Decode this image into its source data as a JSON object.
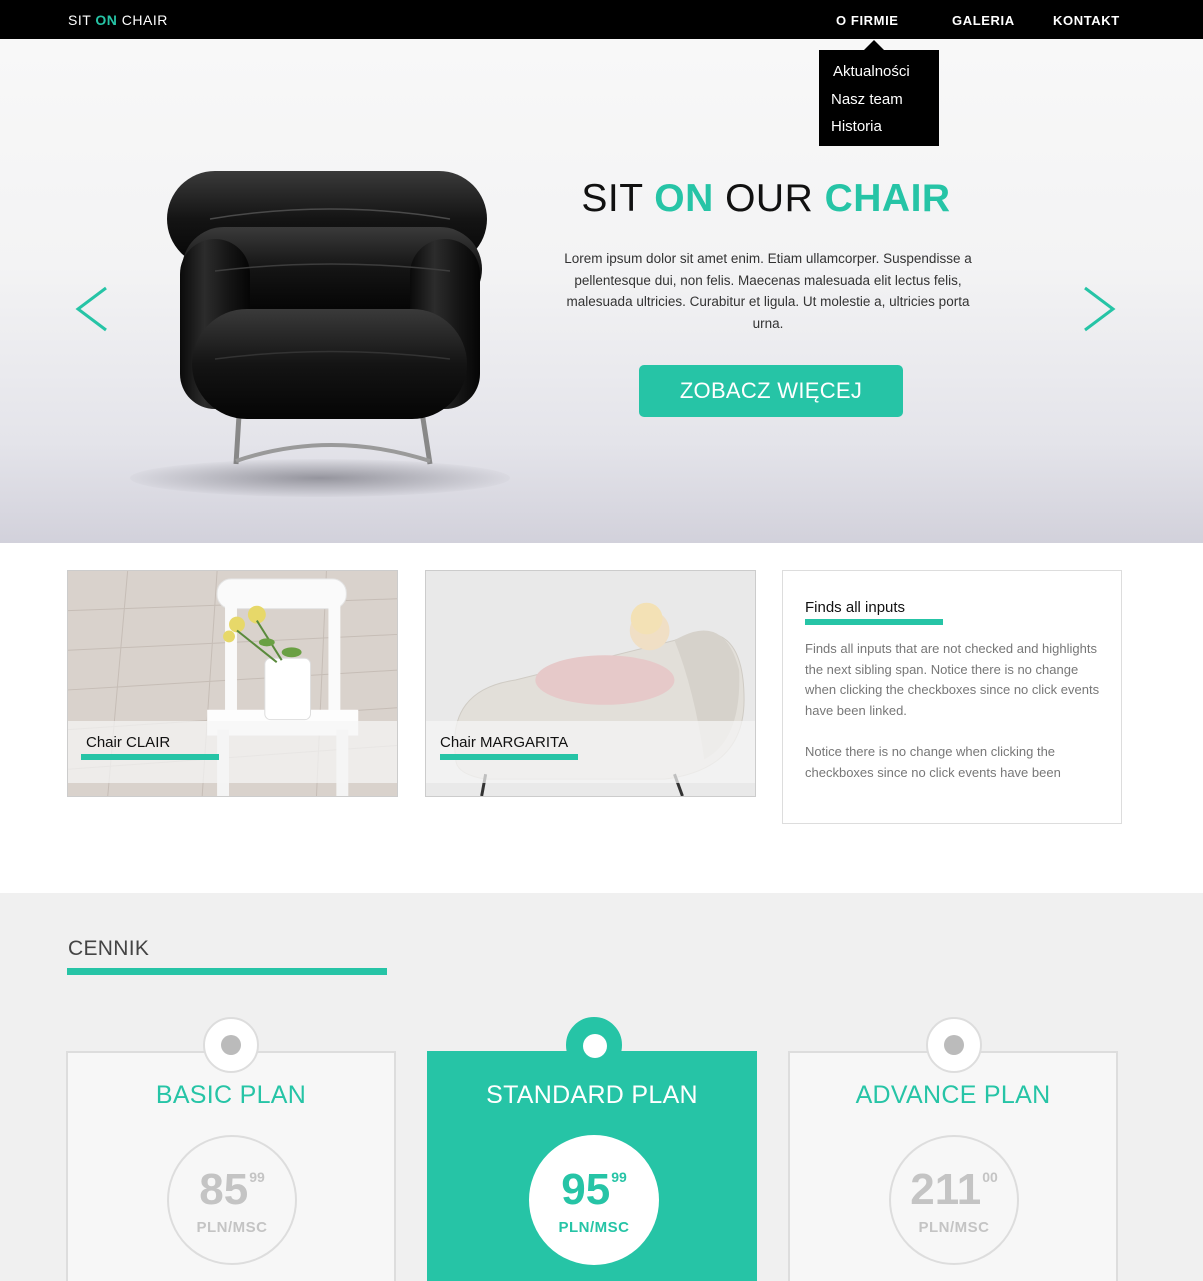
{
  "nav": {
    "logo": {
      "part1": "SIT ",
      "part2": "ON",
      "part3": " CHAIR"
    },
    "links": [
      "O FIRMIE",
      "GALERIA",
      "KONTAKT"
    ],
    "dropdown": [
      "Aktualności",
      "Nasz team",
      "Historia"
    ]
  },
  "hero": {
    "title": {
      "w1": "SIT ",
      "w2": "ON",
      "w3": " OUR ",
      "w4": "CHAIR"
    },
    "text": "Lorem ipsum dolor sit amet enim. Etiam ullamcorper. Suspendisse a pellentesque dui, non felis. Maecenas malesuada elit lectus felis, malesuada ultricies. Curabitur et ligula. Ut molestie a, ultricies porta urna.",
    "button": "ZOBACZ WIĘCEJ",
    "prev_icon": "chevron-left-icon",
    "next_icon": "chevron-right-icon"
  },
  "cards": [
    {
      "caption": "Chair CLAIR"
    },
    {
      "caption": "Chair MARGARITA"
    }
  ],
  "info": {
    "title": "Finds all inputs",
    "p1": "Finds all inputs that are not checked and highlights the next sibling span. Notice there is no change when clicking the checkboxes since no click events have been linked.",
    "p2": "Notice there is no change when clicking the checkboxes since no click events have been"
  },
  "pricing": {
    "heading": "CENNIK",
    "plans": [
      {
        "name": "BASIC PLAN",
        "price": "85",
        "cents": "99",
        "unit": "PLN/MSC"
      },
      {
        "name": "STANDARD PLAN",
        "price": "95",
        "cents": "99",
        "unit": "PLN/MSC"
      },
      {
        "name": "ADVANCE PLAN",
        "price": "211",
        "cents": "00",
        "unit": "PLN/MSC"
      }
    ]
  },
  "colors": {
    "accent": "#26c4a6",
    "nav_bg": "#000000"
  }
}
